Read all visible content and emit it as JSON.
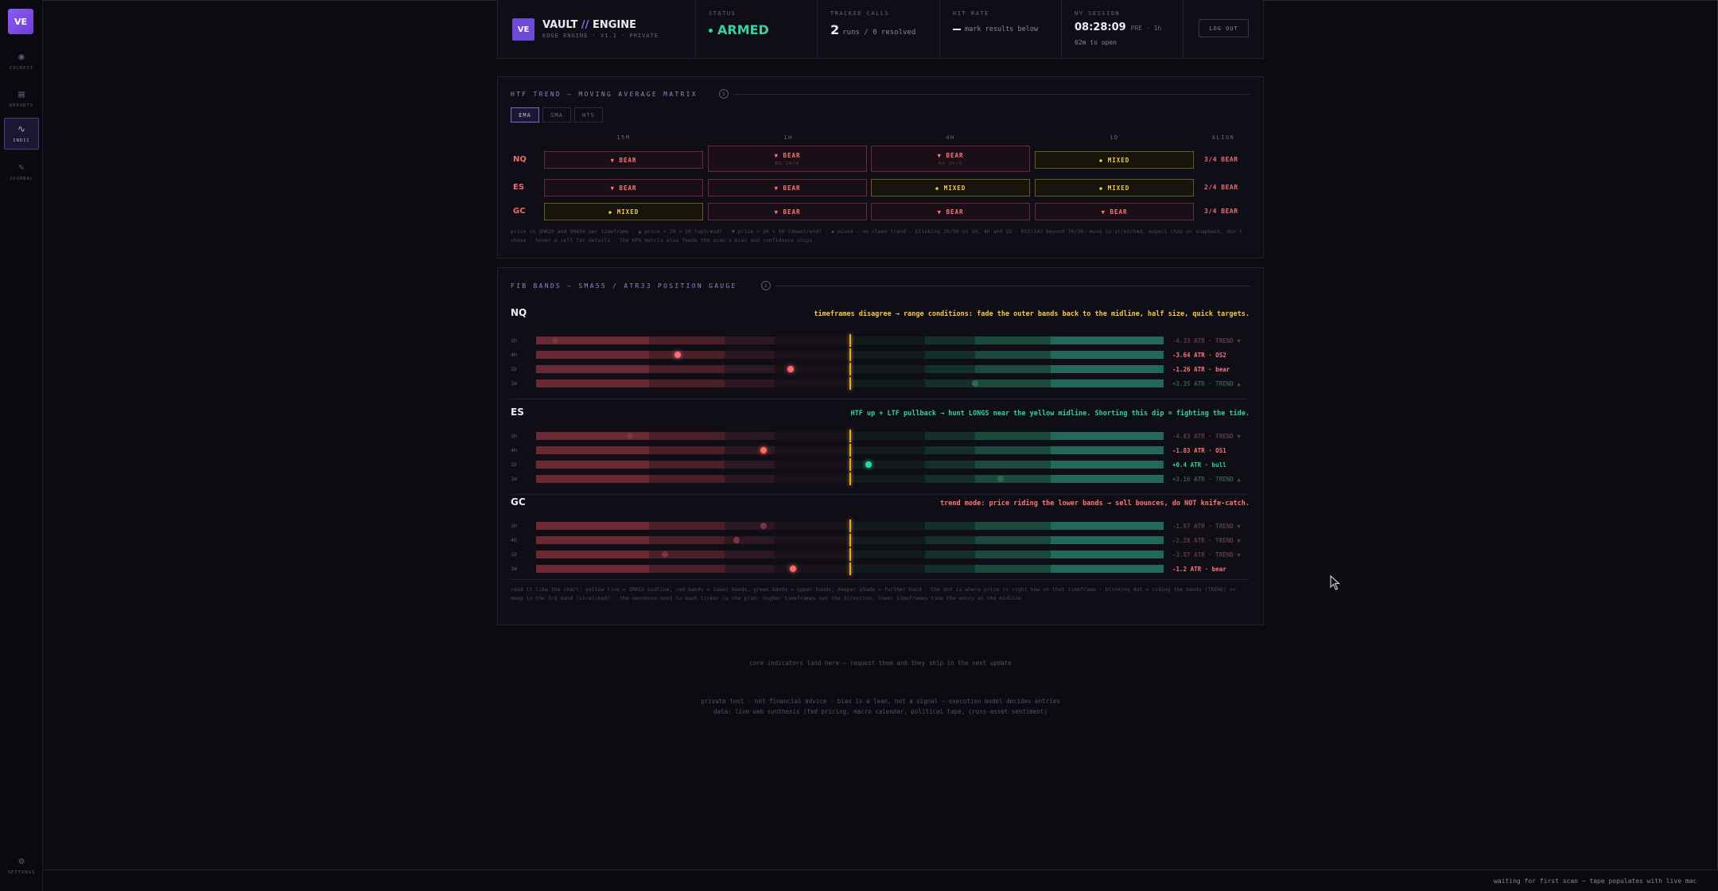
{
  "sidebar": {
    "logo": "VE",
    "items": [
      {
        "icon": "cockpit-icon",
        "label": "COCKPIT",
        "glyph": "◉"
      },
      {
        "icon": "reports-icon",
        "label": "REPORTS",
        "glyph": "▤"
      },
      {
        "icon": "indic-icon",
        "label": "INDIC",
        "glyph": "∿"
      },
      {
        "icon": "journal-icon",
        "label": "JOURNAL",
        "glyph": "✎"
      }
    ],
    "settings": {
      "icon": "settings-icon",
      "label": "SETTINGS",
      "glyph": "⚙"
    }
  },
  "header": {
    "badge": "VE",
    "title_a": "VAULT",
    "title_slash": " // ",
    "title_b": "ENGINE",
    "subtitle": "EDGE ENGINE · V1.1 · PRIVATE",
    "status_label": "STATUS",
    "status_value": "ARMED",
    "calls_label": "TRACKED CALLS",
    "calls_count": "2",
    "calls_detail": "runs / 0 resolved",
    "hit_label": "HIT RATE",
    "hit_detail": "mark results below",
    "session_label": "NY SESSION",
    "session_time": "08:28:09",
    "session_extra": "PRE · 1h",
    "session_open": "02m to open",
    "logout_label": "LOG OUT"
  },
  "htf": {
    "title": "HTF TREND — MOVING AVERAGE MATRIX",
    "tabs": [
      "EMA",
      "SMA",
      "HTS"
    ],
    "active_tab": "EMA",
    "columns": [
      "15M",
      "1H",
      "4H",
      "1D",
      "ALIGN"
    ],
    "rows": [
      {
        "ticker": "NQ",
        "cells": [
          {
            "state": "bear",
            "label": "▼ BEAR",
            "sub": ""
          },
          {
            "state": "bear",
            "label": "▼ BEAR",
            "sub": "RG 20/8"
          },
          {
            "state": "bear",
            "label": "▼ BEAR",
            "sub": "RG 20/8"
          },
          {
            "state": "mixed",
            "label": "◆ MIXED",
            "sub": ""
          }
        ],
        "align": "3/4 BEAR"
      },
      {
        "ticker": "ES",
        "cells": [
          {
            "state": "bear",
            "label": "▼ BEAR",
            "sub": ""
          },
          {
            "state": "bear",
            "label": "▼ BEAR",
            "sub": ""
          },
          {
            "state": "mixed",
            "label": "◆ MIXED",
            "sub": ""
          },
          {
            "state": "mixed",
            "label": "◆ MIXED",
            "sub": ""
          }
        ],
        "align": "2/4 BEAR"
      },
      {
        "ticker": "GC",
        "cells": [
          {
            "state": "mixed",
            "label": "◆ MIXED",
            "sub": ""
          },
          {
            "state": "bear",
            "label": "▼ BEAR",
            "sub": ""
          },
          {
            "state": "bear",
            "label": "▼ BEAR",
            "sub": ""
          },
          {
            "state": "bear",
            "label": "▼ BEAR",
            "sub": ""
          }
        ],
        "align": "3/4 BEAR"
      }
    ],
    "note": "price vs SMA20 and SMA50 per timeframe · ▲ price > 20 > 50 (uptrend) · ▼ price < 20 < 50 (downtrend) · ◆ mixed — no clean trend · blinking 20/50 on 1H, 4H and 1D · RSI(14) beyond 70/30: move is stretched, expect chop or snapback, don't chase · hover a cell for details · the KPA matrix also feeds the scan's bias and confidence chips"
  },
  "fib": {
    "title": "FIB BANDS — SMA55 / ATR33 POSITION GAUGE",
    "tickers": [
      {
        "name": "NQ",
        "advice": "timeframes disagree → range conditions: fade the outer bands back to the midline, half size, quick targets.",
        "advice_color": "#f5c84a",
        "rows": [
          {
            "tf": "1H",
            "pos": 0.03,
            "readout": "-4.33 ATR · TREND ▼",
            "tone": "dim-bear"
          },
          {
            "tf": "4H",
            "pos": 0.225,
            "readout": "-3.64 ATR · OS2",
            "tone": "bear"
          },
          {
            "tf": "1D",
            "pos": 0.405,
            "readout": "-1.26 ATR · bear",
            "tone": "bear"
          },
          {
            "tf": "1W",
            "pos": 0.7,
            "readout": "+3.35 ATR · TREND ▲",
            "tone": "dim-bull"
          }
        ]
      },
      {
        "name": "ES",
        "advice": "HTF up + LTF pullback → hunt LONGS near the yellow midline. Shorting this dip = fighting the tide.",
        "advice_color": "#35d29a",
        "rows": [
          {
            "tf": "1H",
            "pos": 0.15,
            "readout": "-4.83 ATR · TREND ▼",
            "tone": "dim-bear"
          },
          {
            "tf": "4H",
            "pos": 0.362,
            "readout": "-1.83 ATR · OS1",
            "tone": "bear"
          },
          {
            "tf": "1D",
            "pos": 0.53,
            "readout": "+0.4 ATR · bull",
            "tone": "bull"
          },
          {
            "tf": "1W",
            "pos": 0.74,
            "readout": "+3.16 ATR · TREND ▲",
            "tone": "dim-bull"
          }
        ]
      },
      {
        "name": "GC",
        "advice": "trend mode: price riding the lower bands → sell bounces, do NOT knife-catch.",
        "advice_color": "#ff7575",
        "rows": [
          {
            "tf": "1H",
            "pos": 0.362,
            "readout": "-1.87 ATR · TREND ▼",
            "tone": "dim-bear"
          },
          {
            "tf": "4H",
            "pos": 0.32,
            "readout": "-2.28 ATR · TREND ▼",
            "tone": "dim-bear"
          },
          {
            "tf": "1D",
            "pos": 0.205,
            "readout": "-3.87 ATR · TREND ▼",
            "tone": "dim-bear"
          },
          {
            "tf": "1W",
            "pos": 0.41,
            "readout": "-1.2 ATR · bear",
            "tone": "bear"
          }
        ]
      }
    ],
    "note": "read it like the chart: yellow line = SMA55 midline, red bands = lower bands, green bands = upper bands, deeper shade = further band · the dot is where price is right now on that timeframe · blinking dot = riding the bands (TREND) or deep in the 3rd band (stretched) · the sentence next to each ticker is the plan: higher timeframes set the direction, lower timeframes time the entry at the midline"
  },
  "footer": {
    "more": "core indicators land here — request them and they ship in the next update",
    "line1": "private tool · not financial advice · bias is a lean, not a signal — execution model decides entries",
    "line2": "data: live web synthesis (fed pricing, macro calendar, political tape, cross-asset sentiment)"
  },
  "tape": {
    "text": "waiting for first scan — tape populates with live mac"
  },
  "colors": {
    "accent": "#8a5cf6",
    "bear": "#ff7575",
    "bull": "#35d29a",
    "mixed": "#f5c84a",
    "midline": "#e8a52a"
  }
}
